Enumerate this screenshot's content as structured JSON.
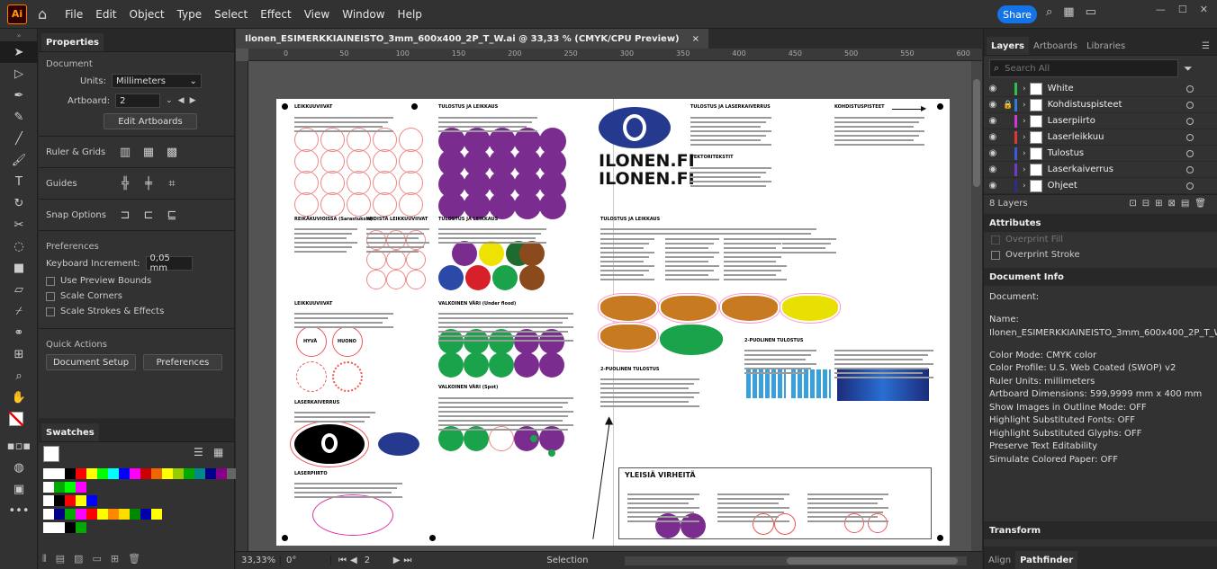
{
  "menubar": {
    "logo": "Ai",
    "menus": [
      "File",
      "Edit",
      "Object",
      "Type",
      "Select",
      "Effect",
      "View",
      "Window",
      "Help"
    ],
    "share_label": "Share"
  },
  "document_tab": {
    "title": "Ilonen_ESIMERKKIAINEISTO_3mm_600x400_2P_T_W.ai @ 33,33 % (CMYK/CPU Preview)",
    "close": "×"
  },
  "ruler": {
    "ticks": [
      "0",
      "50",
      "100",
      "150",
      "200",
      "250",
      "300",
      "350",
      "400",
      "450",
      "500",
      "550",
      "600"
    ]
  },
  "properties": {
    "tab": "Properties",
    "section_document": "Document",
    "units_label": "Units:",
    "units_value": "Millimeters",
    "artboard_label": "Artboard:",
    "artboard_value": "2",
    "edit_artboards": "Edit Artboards",
    "ruler_grids": "Ruler & Grids",
    "guides": "Guides",
    "snap_options": "Snap Options",
    "preferences_section": "Preferences",
    "keyboard_increment_label": "Keyboard Increment:",
    "keyboard_increment_value": "0,05 mm",
    "use_preview_bounds": "Use Preview Bounds",
    "scale_corners": "Scale Corners",
    "scale_strokes": "Scale Strokes & Effects",
    "quick_actions": "Quick Actions",
    "document_setup": "Document Setup",
    "preferences_button": "Preferences"
  },
  "swatches": {
    "tab": "Swatches"
  },
  "status": {
    "zoom": "33,33%",
    "rotation": "0°",
    "artboard": "2",
    "tool": "Selection"
  },
  "layers_panel": {
    "tabs": [
      "Layers",
      "Artboards",
      "Libraries"
    ],
    "search_placeholder": "Search All",
    "count": "8 Layers",
    "layers": [
      {
        "name": "White",
        "color": "#2fbf4b",
        "locked": false
      },
      {
        "name": "Kohdistuspisteet",
        "color": "#2f7bdc",
        "locked": true
      },
      {
        "name": "Laserpiirto",
        "color": "#d03ad0",
        "locked": false
      },
      {
        "name": "Laserleikkuu",
        "color": "#e23535",
        "locked": false
      },
      {
        "name": "Tulostus",
        "color": "#3b5bd8",
        "locked": false
      },
      {
        "name": "Laserkaiverrus",
        "color": "#6e3cc8",
        "locked": false
      },
      {
        "name": "Ohjeet",
        "color": "#2d2d8a",
        "locked": false
      }
    ]
  },
  "attributes": {
    "title": "Attributes",
    "overprint_fill": "Overprint Fill",
    "overprint_stroke": "Overprint Stroke"
  },
  "document_info": {
    "title": "Document Info",
    "lines": [
      "Document:",
      "",
      "Name:",
      "Ilonen_ESIMERKKIAINEISTO_3mm_600x400_2P_T_W.ai",
      "",
      "Color Mode: CMYK color",
      "Color Profile: U.S. Web Coated (SWOP) v2",
      "Ruler Units: millimeters",
      "Artboard Dimensions: 599,9999 mm x 400 mm",
      "Show Images in Outline Mode: OFF",
      "Highlight Substituted Fonts: OFF",
      "Highlight Substituted Glyphs: OFF",
      "Preserve Text Editability",
      "Simulate Colored Paper: OFF"
    ]
  },
  "bottom_panels": {
    "transform": "Transform",
    "align": "Align",
    "pathfinder": "Pathfinder"
  },
  "artboard": {
    "logo_line1": "ILONEN.FI",
    "logo_line2": "ILONEN.FI",
    "yleisia_title": "YLEISIÄ VIRHEITÄ",
    "hyva": "HYVÄ",
    "huono": "HUONO",
    "headings": {
      "leikkuuviivat": "LEIKKUUVIIVAT",
      "tulostus_leikkaus": "TULOSTUS JA LEIKKAUS",
      "tulostus_kaiverrus": "TULOSTUS JA LASERKAIVERRUS",
      "kohdistuspisteet": "KOHDISTUSPISTEET",
      "reikakuvioissa": "REIKÄKUVIOISSA (Sarastuksia)",
      "yhdista": "YHDISTÄ LEIKKUUVIIVAT",
      "tulostus_leikkaus2": "TULOSTUS JA LEIKKAUS",
      "vektori": "VEKTORITEKSTIT",
      "laserkaiverrus": "LASERKAIVERRUS",
      "valkoinen": "VALKOINEN VÄRI (Under flood)",
      "valkoinen2": "VALKOINEN VÄRI (Spot)",
      "kaksipuolinen": "2-PUOLINEN TULOSTUS",
      "laserpiirto": "LASERPIIRTO",
      "tulostus_png": "TULOSTUS JA LEIKKAUS",
      "kaksipuolinen2": "2-PUOLINEN TULOSTUS"
    }
  }
}
